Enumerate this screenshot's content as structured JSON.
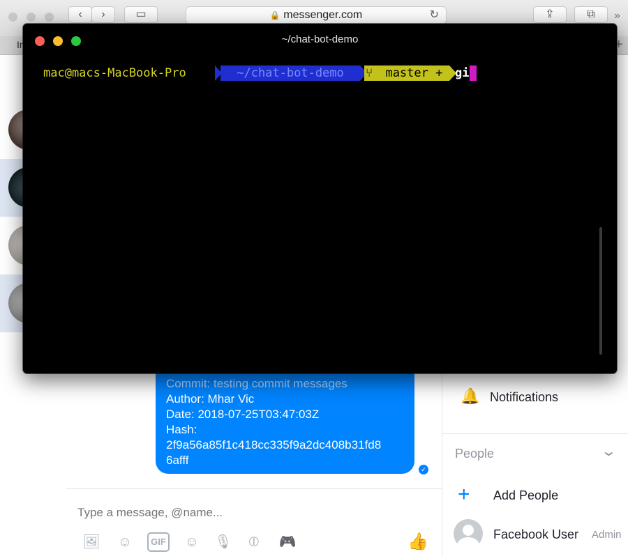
{
  "browser": {
    "url": "messenger.com",
    "tab_fragment": "In"
  },
  "terminal": {
    "title": "~/chat-bot-demo",
    "prompt_user": "mac@macs-MacBook-Pro",
    "prompt_path": "~/chat-bot-demo",
    "prompt_branch": "master +",
    "typed_command": "gi"
  },
  "chat": {
    "message_lines": [
      "Commit: testing commit messages",
      "Author: Mhar Vic",
      "Date: 2018-07-25T03:47:03Z",
      "Hash:",
      "2f9a56a85f1c418cc335f9a2dc408b31fd8",
      "6afff"
    ],
    "input_placeholder": "Type a message, @name..."
  },
  "composer_icons": [
    "photo-icon",
    "sticker-icon",
    "gif-icon",
    "emoji-icon",
    "microphone-icon",
    "poll-icon",
    "game-controller-icon",
    "like-icon"
  ],
  "gif_label": "GIF",
  "right_panel": {
    "notifications_label": "Notifications",
    "people_header": "People",
    "add_people_label": "Add People",
    "member_name": "Facebook User",
    "member_role": "Admin"
  },
  "colors": {
    "messenger_blue": "#0084ff",
    "prompt_user": "#d6d420",
    "prompt_path_bg": "#1f2fcf",
    "prompt_branch_bg": "#c2c21a",
    "cursor": "#d01cc7"
  }
}
